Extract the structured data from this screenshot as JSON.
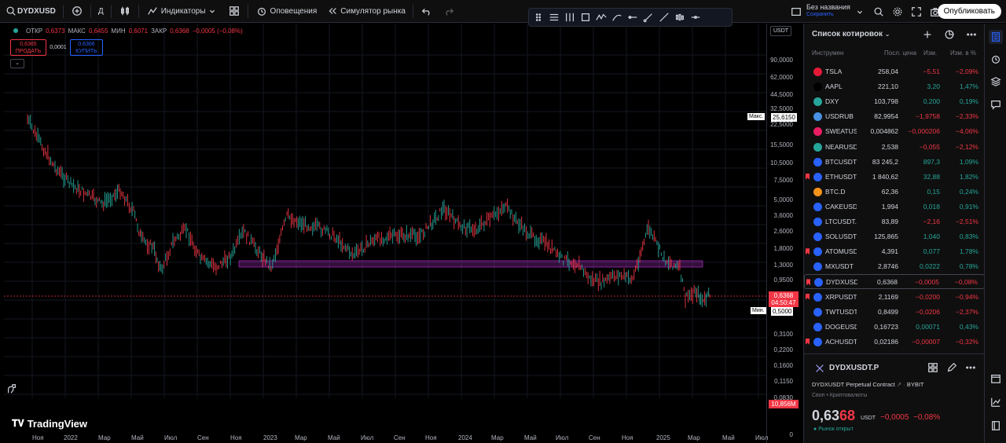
{
  "topbar": {
    "symbol": "DYDXUSD",
    "interval": "Д",
    "indicators": "Индикаторы",
    "alerts": "Оповещения",
    "replay": "Симулятор рынка",
    "layout_name": "Без названия",
    "layout_saved": "Сохранить",
    "publish": "Опубликовать"
  },
  "chart": {
    "ohlc": {
      "open_label": "ОТКР",
      "open": "0,6373",
      "high_label": "МАКС",
      "high": "0,6455",
      "low_label": "МИН",
      "low": "0,6071",
      "close_label": "ЗАКР",
      "close": "0,6368",
      "change": "−0,0005 (−0,08%)"
    },
    "sell_price": "0,6365",
    "sell_label": "ПРОДАТЬ",
    "spread": "0,0001",
    "buy_price": "0,6366",
    "buy_label": "КУПИТЬ",
    "currency": "USDT",
    "max_label": "Макс.",
    "max_value": "25,6150",
    "min_label": "Мин.",
    "min_value": "0,5000",
    "current_price": "0,6368",
    "countdown": "04:50:47",
    "volume_value": "10,856M",
    "price_ticks": [
      "90,0000",
      "62,0000",
      "44,5000",
      "32,5000",
      "22,5000",
      "15,5000",
      "10,5000",
      "7,5000",
      "5,0000",
      "3,6000",
      "2,6000",
      "1,8000",
      "1,3000",
      "0,9500",
      "0,3100",
      "0,2200",
      "0,1600",
      "0,1150",
      "0,0830",
      "0"
    ],
    "time_ticks": [
      "Ноя",
      "2022",
      "Мар",
      "Май",
      "Июл",
      "Сен",
      "Ноя",
      "2023",
      "Мар",
      "Май",
      "Июл",
      "Сен",
      "Ноя",
      "2024",
      "Мар",
      "Май",
      "Июл",
      "Сен",
      "Ноя",
      "2025",
      "Мар",
      "Май",
      "Июл"
    ],
    "logo_text": "TradingView",
    "up_color": "#26a69a",
    "down_color": "#f23645",
    "zone_color": "#9c27b0"
  },
  "watchlist": {
    "title": "Список котировок",
    "col_symbol": "Инструмен",
    "col_last": "Посл. цена",
    "col_chg": "Изм.",
    "col_pct": "Изм. в %",
    "rows": [
      {
        "sym": "TSLA",
        "last": "258,04",
        "chg": "−5,51",
        "pct": "−2,09%",
        "dir": "dn",
        "flag": false,
        "icon_color": "#e31937"
      },
      {
        "sym": "AAPL",
        "last": "221,10",
        "chg": "3,20",
        "pct": "1,47%",
        "dir": "up",
        "flag": false,
        "icon_color": "#000000"
      },
      {
        "sym": "DXY",
        "last": "103,798",
        "chg": "0,200",
        "pct": "0,19%",
        "dir": "up",
        "flag": false,
        "icon_color": "#26a69a"
      },
      {
        "sym": "USDRUB",
        "last": "82,9954",
        "chg": "−1,9758",
        "pct": "−2,33%",
        "dir": "dn",
        "flag": false,
        "icon_color": "#4a90e2"
      },
      {
        "sym": "SWEATUSDT",
        "last": "0,004862",
        "chg": "−0,000206",
        "pct": "−4,06%",
        "dir": "dn",
        "flag": false,
        "icon_color": "#e91e63"
      },
      {
        "sym": "NEARUSDT",
        "last": "2,538",
        "chg": "−0,055",
        "pct": "−2,12%",
        "dir": "dn",
        "flag": false,
        "icon_color": "#26a69a"
      },
      {
        "sym": "BTCUSDT.P",
        "last": "83 245,2",
        "chg": "897,3",
        "pct": "1,09%",
        "dir": "up",
        "flag": false,
        "icon_color": "#2962ff"
      },
      {
        "sym": "ETHUSDT",
        "last": "1 840,62",
        "chg": "32,88",
        "pct": "1,82%",
        "dir": "up",
        "flag": true,
        "icon_color": "#2962ff"
      },
      {
        "sym": "BTC.D",
        "last": "62,36",
        "chg": "0,15",
        "pct": "0,24%",
        "dir": "up",
        "flag": false,
        "icon_color": "#f7931a"
      },
      {
        "sym": "CAKEUSDT",
        "last": "1,994",
        "chg": "0,018",
        "pct": "0,91%",
        "dir": "up",
        "flag": false,
        "icon_color": "#2962ff"
      },
      {
        "sym": "LTCUSDT.P",
        "last": "83,89",
        "chg": "−2,16",
        "pct": "−2,51%",
        "dir": "dn",
        "flag": false,
        "icon_color": "#2962ff"
      },
      {
        "sym": "SOLUSDT",
        "last": "125,865",
        "chg": "1,040",
        "pct": "0,83%",
        "dir": "up",
        "flag": false,
        "icon_color": "#2962ff"
      },
      {
        "sym": "ATOMUSDT",
        "last": "4,391",
        "chg": "0,077",
        "pct": "1,78%",
        "dir": "up",
        "flag": true,
        "icon_color": "#2962ff"
      },
      {
        "sym": "MXUSDT",
        "last": "2,8746",
        "chg": "0,0222",
        "pct": "0,78%",
        "dir": "up",
        "flag": false,
        "icon_color": "#2962ff"
      },
      {
        "sym": "DYDXUSDT",
        "last": "0,6368",
        "chg": "−0,0005",
        "pct": "−0,08%",
        "dir": "dn",
        "flag": true,
        "icon_color": "#2962ff",
        "selected": true
      },
      {
        "sym": "XRPUSDT",
        "last": "2,1169",
        "chg": "−0,0200",
        "pct": "−0,94%",
        "dir": "dn",
        "flag": true,
        "icon_color": "#2962ff"
      },
      {
        "sym": "TWTUSDT",
        "last": "0,8499",
        "chg": "−0,0206",
        "pct": "−2,37%",
        "dir": "dn",
        "flag": false,
        "icon_color": "#2962ff"
      },
      {
        "sym": "DOGEUSDT",
        "last": "0,16723",
        "chg": "0,00071",
        "pct": "0,43%",
        "dir": "up",
        "flag": false,
        "icon_color": "#2962ff"
      },
      {
        "sym": "ACHUSDT",
        "last": "0,02186",
        "chg": "−0,00007",
        "pct": "−0,32%",
        "dir": "dn",
        "flag": true,
        "icon_color": "#2962ff"
      }
    ]
  },
  "details": {
    "symbol": "DYDXUSDT.P",
    "description": "DYDXUSDT Perpetual Contract",
    "exchange": "BYBIT",
    "type": "Своп • Криптовалюты",
    "price_main": "0,63",
    "price_frac": "68",
    "currency": "USDT",
    "change": "−0,0005",
    "change_pct": "−0,08%",
    "market_status": "Рынок открыт"
  }
}
